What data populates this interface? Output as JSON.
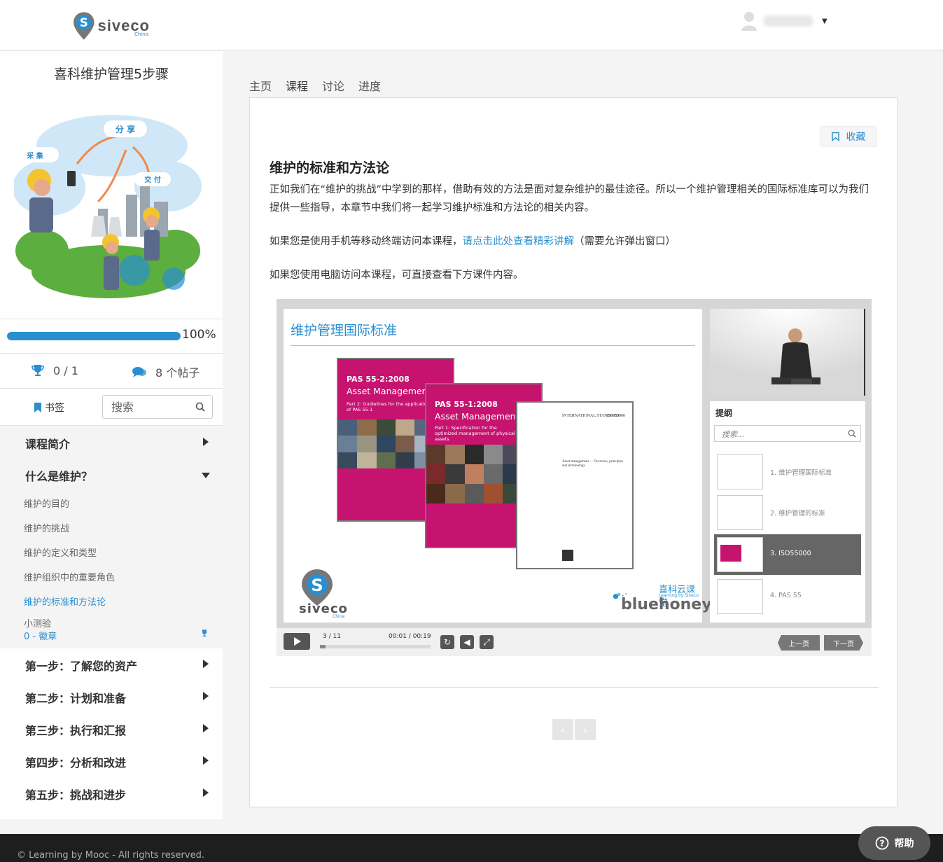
{
  "header": {
    "logo_text": "siveco",
    "logo_sub": "China"
  },
  "sidebar": {
    "course_title": "喜科维护管理5步骤",
    "illustration": {
      "share": "分 享",
      "collect": "采 集",
      "deliver": "交 付"
    },
    "progress": {
      "value": 100,
      "label": "100%"
    },
    "achievements": "0 / 1",
    "posts": "8 个帖子",
    "bookmark_label": "书签",
    "search_placeholder": "搜索",
    "sections": [
      {
        "label": "课程简介"
      },
      {
        "label": "什么是维护？"
      },
      {
        "label": "第一步：了解您的资产"
      },
      {
        "label": "第二步：计划和准备"
      },
      {
        "label": "第三步：执行和汇报"
      },
      {
        "label": "第四步：分析和改进"
      },
      {
        "label": "第五步：挑战和进步"
      }
    ],
    "sub_items": [
      {
        "label": "维护的目的"
      },
      {
        "label": "维护的挑战"
      },
      {
        "label": "维护的定义和类型"
      },
      {
        "label": "维护组织中的重要角色"
      },
      {
        "label": "维护的标准和方法论"
      }
    ],
    "quiz": {
      "label": "小测验",
      "badge": "0 - 徽章"
    }
  },
  "tabs": [
    {
      "label": "主页"
    },
    {
      "label": "课程"
    },
    {
      "label": "讨论"
    },
    {
      "label": "进度"
    }
  ],
  "content": {
    "favorite_label": "收藏",
    "title": "维护的标准和方法论",
    "para1": "正如我们在“维护的挑战”中学到的那样，借助有效的方法是面对复杂维护的最佳途径。所以一个维护管理相关的国际标准库可以为我们提供一些指导，本章节中我们将一起学习维护标准和方法论的相关内容。",
    "para2_pre": "如果您是使用手机等移动终端访问本课程，",
    "para2_link": "请点击此处查看精彩讲解",
    "para2_post": "（需要允许弹出窗口）",
    "para3": "如果您使用电脑访问本课程，可直接查看下方课件内容。"
  },
  "player": {
    "slide_title": "维护管理国际标准",
    "book1": {
      "hdr": "PAS 55-2:2008",
      "title": "Asset Management",
      "sub": "Part 2: Guidelines for the application of PAS 55-1"
    },
    "book2": {
      "hdr": "PAS 55-1:2008",
      "title": "Asset Management",
      "sub": "Part 1: Specification for the optimized management of physical assets"
    },
    "iso_doc": {
      "left": "INTERNATIONAL STANDARD",
      "right": "ISO 55000",
      "body": "Asset management — Overview, principles and terminology"
    },
    "brand_text": "siveco",
    "brand_sub": "China",
    "bluehoney_zh": "喜科云课堂",
    "bluehoney_en": "Learning by Siveco",
    "bluehoney_word": "bluehoney",
    "outline_title": "提纲",
    "outline_search_placeholder": "搜索...",
    "outline_items": [
      {
        "label": "1. 维护管理国际标准"
      },
      {
        "label": "2. 维护管理的标准"
      },
      {
        "label": "3. ISO55000"
      },
      {
        "label": "4. PAS 55"
      }
    ],
    "slide_counter": "3 / 11",
    "time": "00:01 / 00:19",
    "scrub_progress": 0.05,
    "prev_label": "上一页",
    "next_label": "下一页"
  },
  "footer": {
    "copyright": "© Learning by Mooc - All rights reserved."
  },
  "help_label": "帮助",
  "colors": {
    "accent": "#2a8fd0",
    "book": "#c6136f"
  }
}
